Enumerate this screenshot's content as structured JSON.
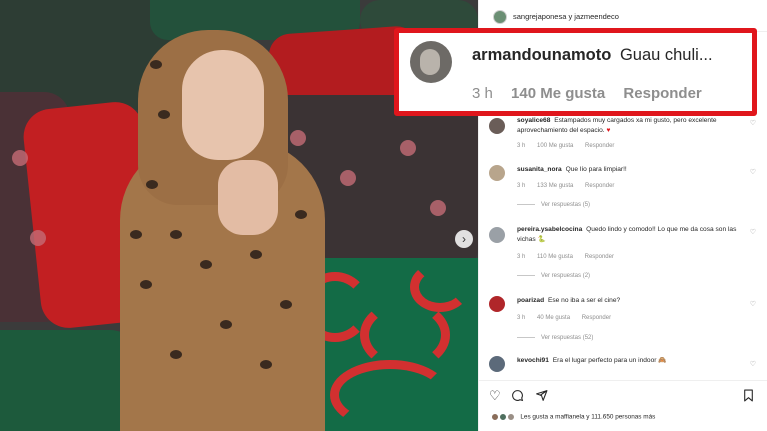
{
  "header": {
    "usernames": "sangrejaponesa y jazmeendeco"
  },
  "highlight": {
    "username": "armandounamoto",
    "text": "Guau chuli...",
    "time": "3 h",
    "likes": "140 Me gusta",
    "reply": "Responder",
    "border_color": "#e0161c"
  },
  "comments": [
    {
      "username": "soyalice68",
      "text": "Estampados muy cargados xa mi gusto, pero excelente aprovechamiento del espacio.",
      "emoji": "♥",
      "time": "3 h",
      "likes": "100 Me gusta",
      "reply": "Responder",
      "replies": ""
    },
    {
      "username": "susanita_nora",
      "text": "Que lío para limpiar!!",
      "emoji": "",
      "time": "3 h",
      "likes": "133 Me gusta",
      "reply": "Responder",
      "replies": "Ver respuestas (5)"
    },
    {
      "username": "pereira.ysabelcocina",
      "text": "Quedo lindo y comodo!! Lo que me da cosa son las vichas",
      "emoji": "🐍",
      "time": "3 h",
      "likes": "110 Me gusta",
      "reply": "Responder",
      "replies": "Ver respuestas (2)"
    },
    {
      "username": "poarizad",
      "text": "Ese no iba a ser el cine?",
      "emoji": "",
      "time": "3 h",
      "likes": "40 Me gusta",
      "reply": "Responder",
      "replies": "Ver respuestas (52)"
    },
    {
      "username": "kevochi91",
      "text": "Era el lugar perfecto para un indoor",
      "emoji": "🙈",
      "time": "",
      "likes": "",
      "reply": "",
      "replies": ""
    }
  ],
  "footer": {
    "likes_summary": "Les gusta a maffianela y 111.650 personas más"
  },
  "icons": [
    "heart-icon",
    "comment-icon",
    "share-icon",
    "bookmark-icon",
    "chevron-right-icon"
  ]
}
